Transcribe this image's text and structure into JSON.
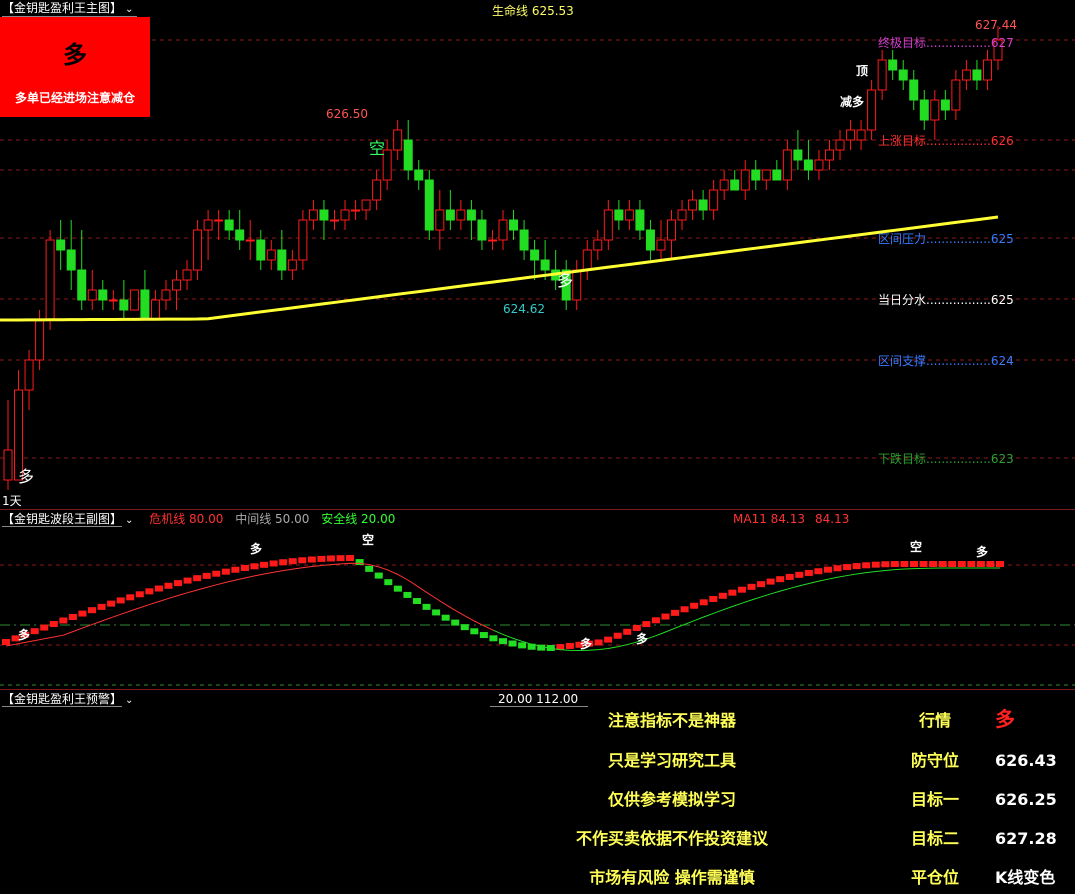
{
  "main": {
    "title": "【金钥匙盈利王主图】",
    "lifeline_label": "生命线 625.53",
    "signal_box": {
      "big": "多",
      "note": "多单已经进场注意减仓"
    },
    "period": "1天",
    "annotations": {
      "high_label": "626.50",
      "low_label": "624.62",
      "top_price": "627.44",
      "kong": "空",
      "duo_bottom": "多",
      "duo_mid": "多",
      "top_marker": "顶",
      "reduce_marker": "减多"
    },
    "right_labels": [
      {
        "text": "终极目标.................627",
        "color": "#d040d0"
      },
      {
        "text": "上涨目标.................626",
        "color": "#ff3030"
      },
      {
        "text": "区间压力.................625",
        "color": "#3a7bff"
      },
      {
        "text": "当日分水.................625",
        "color": "#ffffff"
      },
      {
        "text": "区间支撑.................624",
        "color": "#3a7bff"
      },
      {
        "text": "下跌目标.................623",
        "color": "#2ea02e"
      }
    ]
  },
  "sub": {
    "title": "【金钥匙波段王副图】",
    "danger": "危机线 80.00",
    "middle": "中间线 50.00",
    "safe": "安全线 20.00",
    "ma": "MA11 84.13",
    "ma_val": "84.13",
    "markers": [
      "多",
      "多",
      "空",
      "多",
      "多",
      "空",
      "多"
    ]
  },
  "warn": {
    "title": "【金钥匙盈利王预警】",
    "nums": "20.00    112.00",
    "notes": [
      "注意指标不是神器",
      "只是学习研究工具",
      "仅供参考模拟学习",
      "不作买卖依据不作投资建议",
      "市场有风险 操作需谨慎"
    ],
    "keys": [
      "行情",
      "防守位",
      "目标一",
      "目标二",
      "平仓位"
    ],
    "values": [
      "多",
      "626.43",
      "626.25",
      "627.28",
      "K线变色"
    ]
  },
  "colors": {
    "up": "#ff1a1a",
    "down": "#22dd22",
    "lifeline": "#ffff33",
    "grid": "#8b1a1a"
  },
  "chart_data": {
    "type": "candlestick",
    "title": "",
    "candles_ohlc": [
      [
        622.9,
        623.7,
        622.8,
        623.2
      ],
      [
        622.9,
        624.0,
        622.9,
        623.8
      ],
      [
        623.8,
        624.2,
        623.6,
        624.1
      ],
      [
        624.1,
        624.6,
        624.0,
        624.5
      ],
      [
        624.5,
        625.4,
        624.4,
        625.3
      ],
      [
        625.3,
        625.5,
        625.0,
        625.2
      ],
      [
        625.2,
        625.5,
        624.8,
        625.0
      ],
      [
        625.0,
        625.4,
        624.6,
        624.7
      ],
      [
        624.7,
        625.0,
        624.6,
        624.8
      ],
      [
        624.8,
        624.9,
        624.6,
        624.7
      ],
      [
        624.7,
        624.8,
        624.6,
        624.7
      ],
      [
        624.7,
        624.9,
        624.5,
        624.6
      ],
      [
        624.6,
        624.8,
        624.6,
        624.8
      ],
      [
        624.8,
        625.0,
        624.5,
        624.5
      ],
      [
        624.5,
        624.8,
        624.5,
        624.7
      ],
      [
        624.7,
        624.9,
        624.6,
        624.8
      ],
      [
        624.8,
        625.0,
        624.6,
        624.9
      ],
      [
        624.9,
        625.1,
        624.8,
        625.0
      ],
      [
        625.0,
        625.5,
        624.9,
        625.4
      ],
      [
        625.4,
        625.6,
        625.1,
        625.5
      ],
      [
        625.5,
        625.6,
        625.3,
        625.5
      ],
      [
        625.5,
        625.6,
        625.3,
        625.4
      ],
      [
        625.4,
        625.6,
        625.2,
        625.3
      ],
      [
        625.3,
        625.5,
        625.1,
        625.3
      ],
      [
        625.3,
        625.4,
        625.0,
        625.1
      ],
      [
        625.1,
        625.3,
        625.0,
        625.2
      ],
      [
        625.2,
        625.4,
        624.9,
        625.0
      ],
      [
        625.0,
        625.2,
        624.9,
        625.1
      ],
      [
        625.1,
        625.6,
        625.0,
        625.5
      ],
      [
        625.5,
        625.7,
        625.4,
        625.6
      ],
      [
        625.6,
        625.7,
        625.3,
        625.5
      ],
      [
        625.5,
        625.6,
        625.4,
        625.5
      ],
      [
        625.5,
        625.7,
        625.4,
        625.6
      ],
      [
        625.6,
        625.7,
        625.5,
        625.6
      ],
      [
        625.6,
        625.7,
        625.5,
        625.7
      ],
      [
        625.7,
        626.0,
        625.6,
        625.9
      ],
      [
        625.9,
        626.3,
        625.8,
        626.2
      ],
      [
        626.2,
        626.5,
        626.1,
        626.4
      ],
      [
        626.3,
        626.5,
        625.9,
        626.0
      ],
      [
        626.0,
        626.1,
        625.8,
        625.9
      ],
      [
        625.9,
        626.0,
        625.3,
        625.4
      ],
      [
        625.4,
        625.8,
        625.2,
        625.6
      ],
      [
        625.6,
        625.8,
        625.4,
        625.5
      ],
      [
        625.5,
        625.7,
        625.4,
        625.6
      ],
      [
        625.6,
        625.7,
        625.3,
        625.5
      ],
      [
        625.5,
        625.6,
        625.2,
        625.3
      ],
      [
        625.3,
        625.4,
        625.2,
        625.3
      ],
      [
        625.3,
        625.6,
        625.2,
        625.5
      ],
      [
        625.5,
        625.6,
        625.3,
        625.4
      ],
      [
        625.4,
        625.5,
        625.1,
        625.2
      ],
      [
        625.2,
        625.3,
        624.9,
        625.1
      ],
      [
        625.1,
        625.3,
        624.9,
        625.0
      ],
      [
        625.0,
        625.2,
        624.8,
        624.9
      ],
      [
        625.0,
        625.1,
        624.6,
        624.7
      ],
      [
        624.7,
        625.1,
        624.6,
        625.0
      ],
      [
        625.0,
        625.3,
        624.9,
        625.2
      ],
      [
        625.2,
        625.4,
        625.1,
        625.3
      ],
      [
        625.3,
        625.7,
        625.2,
        625.6
      ],
      [
        625.6,
        625.7,
        625.4,
        625.5
      ],
      [
        625.5,
        625.7,
        625.4,
        625.6
      ],
      [
        625.6,
        625.7,
        625.3,
        625.4
      ],
      [
        625.4,
        625.5,
        625.1,
        625.2
      ],
      [
        625.2,
        625.5,
        625.1,
        625.3
      ],
      [
        625.3,
        625.6,
        625.1,
        625.5
      ],
      [
        625.5,
        625.7,
        625.4,
        625.6
      ],
      [
        625.6,
        625.8,
        625.5,
        625.7
      ],
      [
        625.7,
        625.8,
        625.5,
        625.6
      ],
      [
        625.6,
        625.9,
        625.5,
        625.8
      ],
      [
        625.8,
        626.0,
        625.7,
        625.9
      ],
      [
        625.9,
        626.0,
        625.8,
        625.8
      ],
      [
        625.8,
        626.1,
        625.7,
        626.0
      ],
      [
        626.0,
        626.1,
        625.8,
        625.9
      ],
      [
        625.9,
        626.0,
        625.8,
        626.0
      ],
      [
        626.0,
        626.1,
        625.9,
        625.9
      ],
      [
        625.9,
        626.3,
        625.8,
        626.2
      ],
      [
        626.2,
        626.4,
        626.0,
        626.1
      ],
      [
        626.1,
        626.3,
        625.9,
        626.0
      ],
      [
        626.0,
        626.2,
        625.9,
        626.1
      ],
      [
        626.1,
        626.3,
        626.0,
        626.2
      ],
      [
        626.2,
        626.4,
        626.1,
        626.3
      ],
      [
        626.3,
        626.5,
        626.2,
        626.4
      ],
      [
        626.3,
        626.5,
        626.2,
        626.4
      ],
      [
        626.4,
        626.9,
        626.3,
        626.8
      ],
      [
        626.8,
        627.2,
        626.7,
        627.1
      ],
      [
        627.1,
        627.2,
        626.9,
        627.0
      ],
      [
        627.0,
        627.1,
        626.8,
        626.9
      ],
      [
        626.9,
        627.0,
        626.6,
        626.7
      ],
      [
        626.7,
        626.8,
        626.4,
        626.5
      ],
      [
        626.5,
        626.8,
        626.3,
        626.7
      ],
      [
        626.7,
        626.8,
        626.5,
        626.6
      ],
      [
        626.6,
        627.0,
        626.5,
        626.9
      ],
      [
        626.9,
        627.1,
        626.8,
        627.0
      ],
      [
        627.0,
        627.1,
        626.8,
        626.9
      ],
      [
        626.9,
        627.2,
        626.8,
        627.1
      ],
      [
        627.1,
        627.44,
        627.0,
        627.3
      ]
    ],
    "lifeline_start": 624.5,
    "lifeline_end": 625.53
  }
}
